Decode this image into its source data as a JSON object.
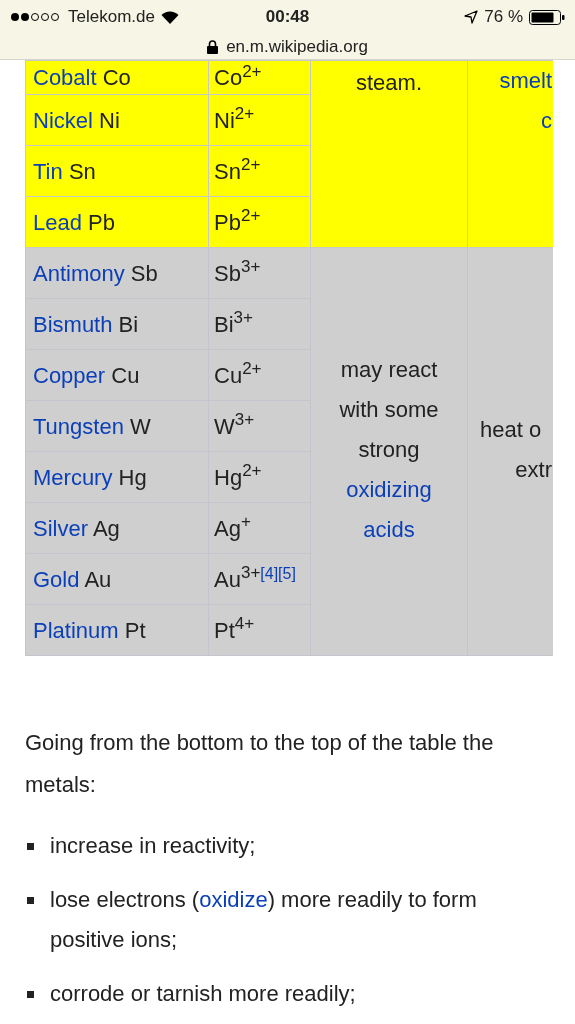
{
  "status_bar": {
    "carrier": "Telekom.de",
    "time": "00:48",
    "battery": "76 %"
  },
  "address_bar": {
    "url": "en.m.wikipedia.org"
  },
  "table": {
    "groups": [
      {
        "color": "#ffff00",
        "rows": [
          {
            "name": "Cobalt",
            "symbol": "Co",
            "ion": "Co$^{2+}$"
          },
          {
            "name": "Nickel",
            "symbol": "Ni",
            "ion": "Ni$^{2+}$"
          },
          {
            "name": "Tin",
            "symbol": "Sn",
            "ion": "Sn$^{2+}$"
          },
          {
            "name": "Lead",
            "symbol": "Pb",
            "ion": "Pb$^{2+}$"
          }
        ],
        "column_3": [
          {
            "text": "steam.",
            "link": false
          }
        ],
        "column_4": [
          {
            "text": "smelt",
            "link": true
          },
          {
            "text": "c",
            "link": true
          }
        ]
      },
      {
        "color": "#cfcfcf",
        "rows": [
          {
            "name": "Antimony",
            "symbol": "Sb",
            "ion": "Sb$^{3+}$"
          },
          {
            "name": "Bismuth",
            "symbol": "Bi",
            "ion": "Bi$^{3+}$"
          },
          {
            "name": "Copper",
            "symbol": "Cu",
            "ion": "Cu$^{2+}$"
          },
          {
            "name": "Tungsten",
            "symbol": "W",
            "ion": "W$^{3+}$"
          },
          {
            "name": "Mercury",
            "symbol": "Hg",
            "ion": "Hg$^{2+}$"
          },
          {
            "name": "Silver",
            "symbol": "Ag",
            "ion": "Ag$^{+}$"
          },
          {
            "name": "Gold",
            "symbol": "Au",
            "ion": "Au$^{3+}$",
            "refs": [
              "[4]",
              "[5]"
            ]
          },
          {
            "name": "Platinum",
            "symbol": "Pt",
            "ion": "Pt$^{4+}$"
          }
        ],
        "column_3": [
          {
            "text": "may react",
            "link": false
          },
          {
            "text": "with some",
            "link": false
          },
          {
            "text": "strong",
            "link": false
          },
          {
            "text": "oxidizing",
            "link": true
          },
          {
            "text": "acids",
            "link": true
          }
        ],
        "column_4": [
          {
            "text": "heat o",
            "link": false
          },
          {
            "text": "extr",
            "link": false
          }
        ]
      }
    ]
  },
  "paragraph": "Going from the bottom to the top of the table the metals:",
  "list": [
    {
      "before": "increase in reactivity;"
    },
    {
      "before": "lose electrons (",
      "link": "oxidize",
      "after": ") more readily to form positive ions;"
    },
    {
      "before": "corrode or tarnish more readily;"
    }
  ]
}
